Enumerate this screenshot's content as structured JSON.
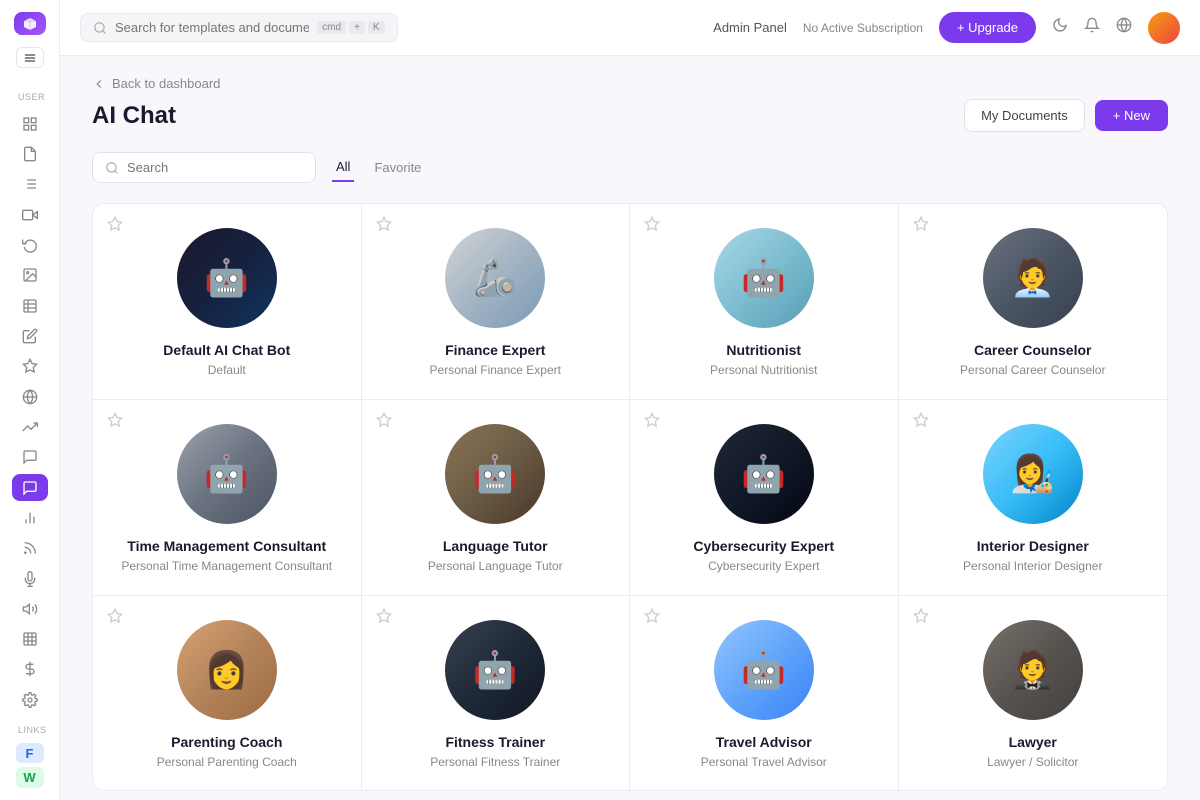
{
  "topbar": {
    "search_placeholder": "Search for templates and documents...",
    "search_shortcut_1": "cmd",
    "search_shortcut_2": "+",
    "search_shortcut_3": "K",
    "admin_panel": "Admin Panel",
    "subscription": "No Active Subscription",
    "upgrade_label": "+ Upgrade"
  },
  "sidebar": {
    "user_label": "USER",
    "links_label": "LINKS",
    "link_f_label": "F",
    "link_w_label": "W"
  },
  "page": {
    "breadcrumb": "Back to dashboard",
    "title": "AI Chat",
    "my_documents": "My Documents",
    "new_button": "+ New"
  },
  "filter": {
    "search_placeholder": "Search",
    "tab_all": "All",
    "tab_favorite": "Favorite"
  },
  "bots": [
    {
      "id": 1,
      "name": "Default AI Chat Bot",
      "desc": "Default",
      "avatar_class": "av-1",
      "icon": "🤖"
    },
    {
      "id": 2,
      "name": "Finance Expert",
      "desc": "Personal Finance Expert",
      "avatar_class": "av-2",
      "icon": "🦾"
    },
    {
      "id": 3,
      "name": "Nutritionist",
      "desc": "Personal Nutritionist",
      "avatar_class": "av-3",
      "icon": "🤖"
    },
    {
      "id": 4,
      "name": "Career Counselor",
      "desc": "Personal Career Counselor",
      "avatar_class": "av-4",
      "icon": "🧑‍💼"
    },
    {
      "id": 5,
      "name": "Time Management Consultant",
      "desc": "Personal Time Management Consultant",
      "avatar_class": "av-5",
      "icon": "🤖"
    },
    {
      "id": 6,
      "name": "Language Tutor",
      "desc": "Personal Language Tutor",
      "avatar_class": "av-6",
      "icon": "🤖"
    },
    {
      "id": 7,
      "name": "Cybersecurity Expert",
      "desc": "Cybersecurity Expert",
      "avatar_class": "av-7",
      "icon": "🤖"
    },
    {
      "id": 8,
      "name": "Interior Designer",
      "desc": "Personal Interior Designer",
      "avatar_class": "av-8",
      "icon": "👩‍🎨"
    },
    {
      "id": 9,
      "name": "Parenting Coach",
      "desc": "Personal Parenting Coach",
      "avatar_class": "av-9",
      "icon": "👩"
    },
    {
      "id": 10,
      "name": "Fitness Trainer",
      "desc": "Personal Fitness Trainer",
      "avatar_class": "av-10",
      "icon": "🤖"
    },
    {
      "id": 11,
      "name": "Travel Advisor",
      "desc": "Personal Travel Advisor",
      "avatar_class": "av-11",
      "icon": "🤖"
    },
    {
      "id": 12,
      "name": "Lawyer",
      "desc": "Lawyer / Solicitor",
      "avatar_class": "av-12",
      "icon": "🤵"
    }
  ]
}
